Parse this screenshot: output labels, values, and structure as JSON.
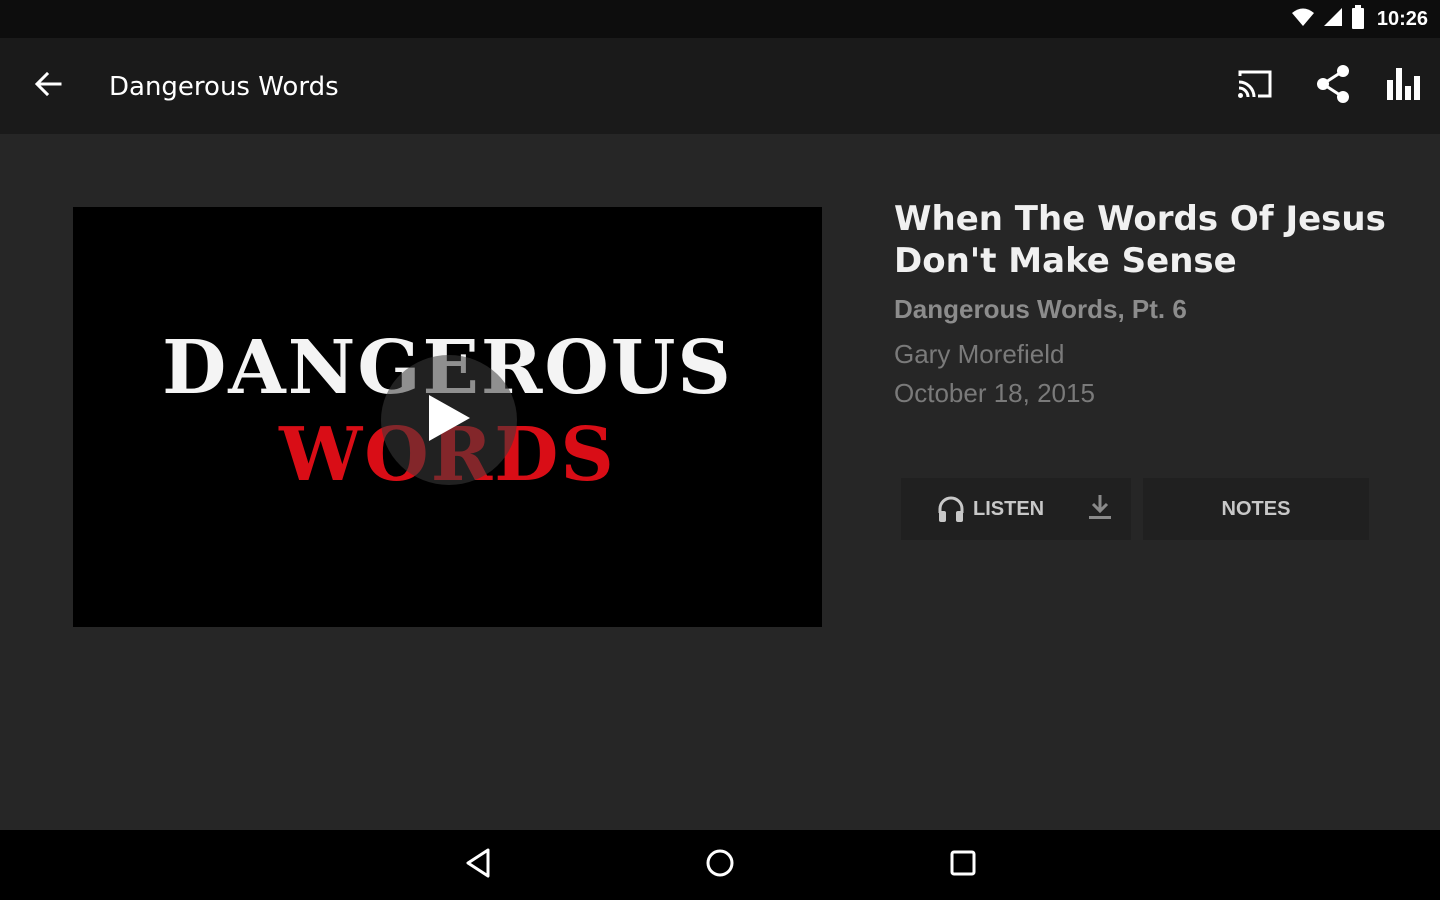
{
  "status_bar": {
    "time": "10:26",
    "icons": [
      "wifi-icon",
      "signal-icon",
      "battery-icon"
    ]
  },
  "app_bar": {
    "title": "Dangerous Words",
    "actions": [
      "cast-icon",
      "share-icon",
      "equalizer-icon"
    ]
  },
  "video": {
    "title_line1": "DANGEROUS",
    "title_line2": "WORDS",
    "accent_color": "#d90d16"
  },
  "episode": {
    "title": "When The Words Of Jesus Don't Make Sense",
    "series": "Dangerous Words, Pt. 6",
    "speaker": "Gary Morefield",
    "date": "October 18, 2015"
  },
  "actions": {
    "listen_label": "LISTEN",
    "notes_label": "NOTES"
  },
  "nav_bar": {
    "buttons": [
      "back-triangle-icon",
      "home-circle-icon",
      "recents-square-icon"
    ]
  }
}
